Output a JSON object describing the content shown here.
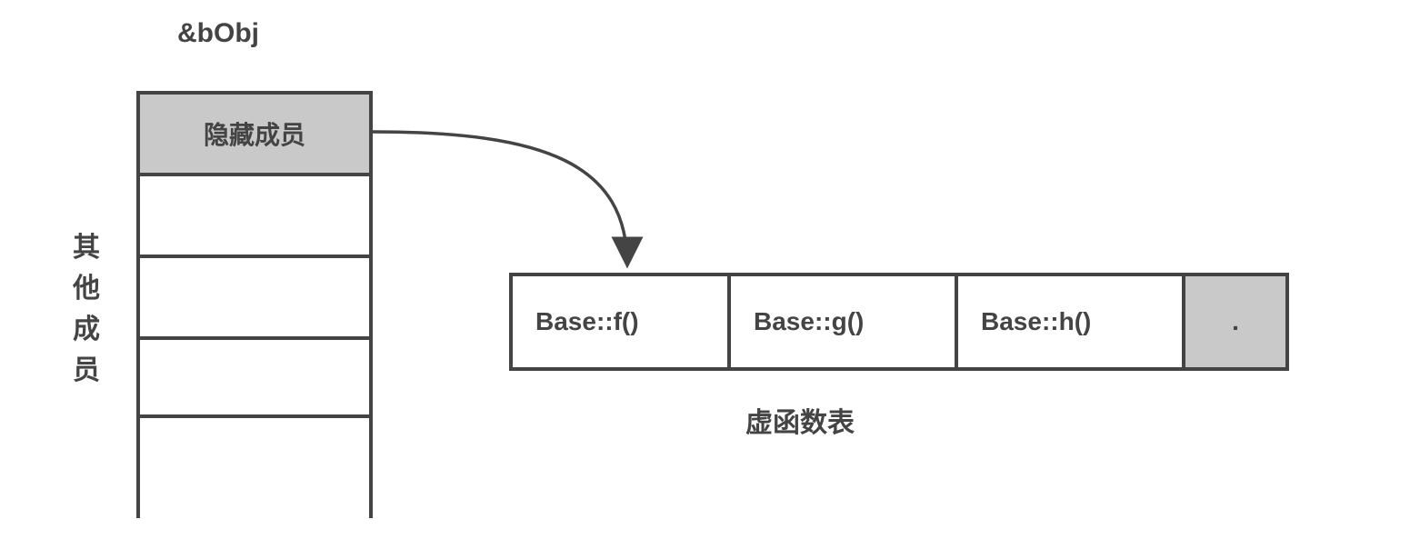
{
  "object": {
    "title": "&bObj",
    "hidden_member_label": "隐藏成员",
    "side_label_chars": [
      "其",
      "他",
      "成",
      "员"
    ]
  },
  "vtable": {
    "label": "虚函数表",
    "cells": [
      "Base::f()",
      "Base::g()",
      "Base::h()",
      "."
    ]
  }
}
